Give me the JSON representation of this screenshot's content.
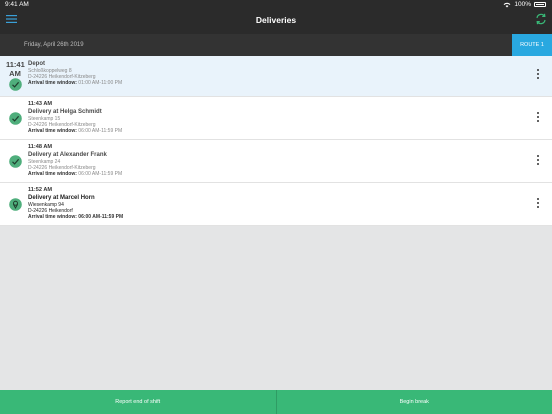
{
  "status_bar": {
    "time": "9:41 AM",
    "battery": "100%"
  },
  "header": {
    "title": "Deliveries"
  },
  "date_bar": {
    "date": "Friday, April 26th 2019",
    "route_tab": "ROUTE 1"
  },
  "stops": [
    {
      "time": "11:41 AM",
      "time_top": "11:41",
      "time_bottom": "AM",
      "name": "Depot",
      "street": "Schloßkoppelweg 8",
      "city": "D-24226 Heikendorf-Kitzeberg",
      "window_label": "Arrival time window:",
      "window_value": "01:00 AM-11:00 PM",
      "status": "done",
      "status_color": "#4fae7c"
    },
    {
      "time": "11:43 AM",
      "name": "Delivery at Helga Schmidt",
      "street": "Steenkamp 15",
      "city": "D-24226 Heikendorf-Kitzeberg",
      "window_label": "Arrival time window:",
      "window_value": "06:00 AM-11:59 PM",
      "status": "done",
      "status_color": "#4fae7c"
    },
    {
      "time": "11:48 AM",
      "name": "Delivery at Alexander Frank",
      "street": "Steenkamp 24",
      "city": "D-24226 Heikendorf-Kitzeberg",
      "window_label": "Arrival time window:",
      "window_value": "06:00 AM-11:59 PM",
      "status": "done",
      "status_color": "#4fae7c"
    },
    {
      "time": "11:52 AM",
      "name": "Delivery at Marcel Horn",
      "street": "Wiesenkamp 94",
      "city": "D-24226 Heikendorf",
      "window_label": "Arrival time window:",
      "window_value": "06:00 AM-11:59 PM",
      "status": "pending",
      "status_color": "#4fae7c"
    }
  ],
  "footer": {
    "end_shift": "Report end of shift",
    "break": "Begin break"
  },
  "colors": {
    "accent": "#29a8e0",
    "footer": "#39b877",
    "header": "#2b2b2b"
  }
}
